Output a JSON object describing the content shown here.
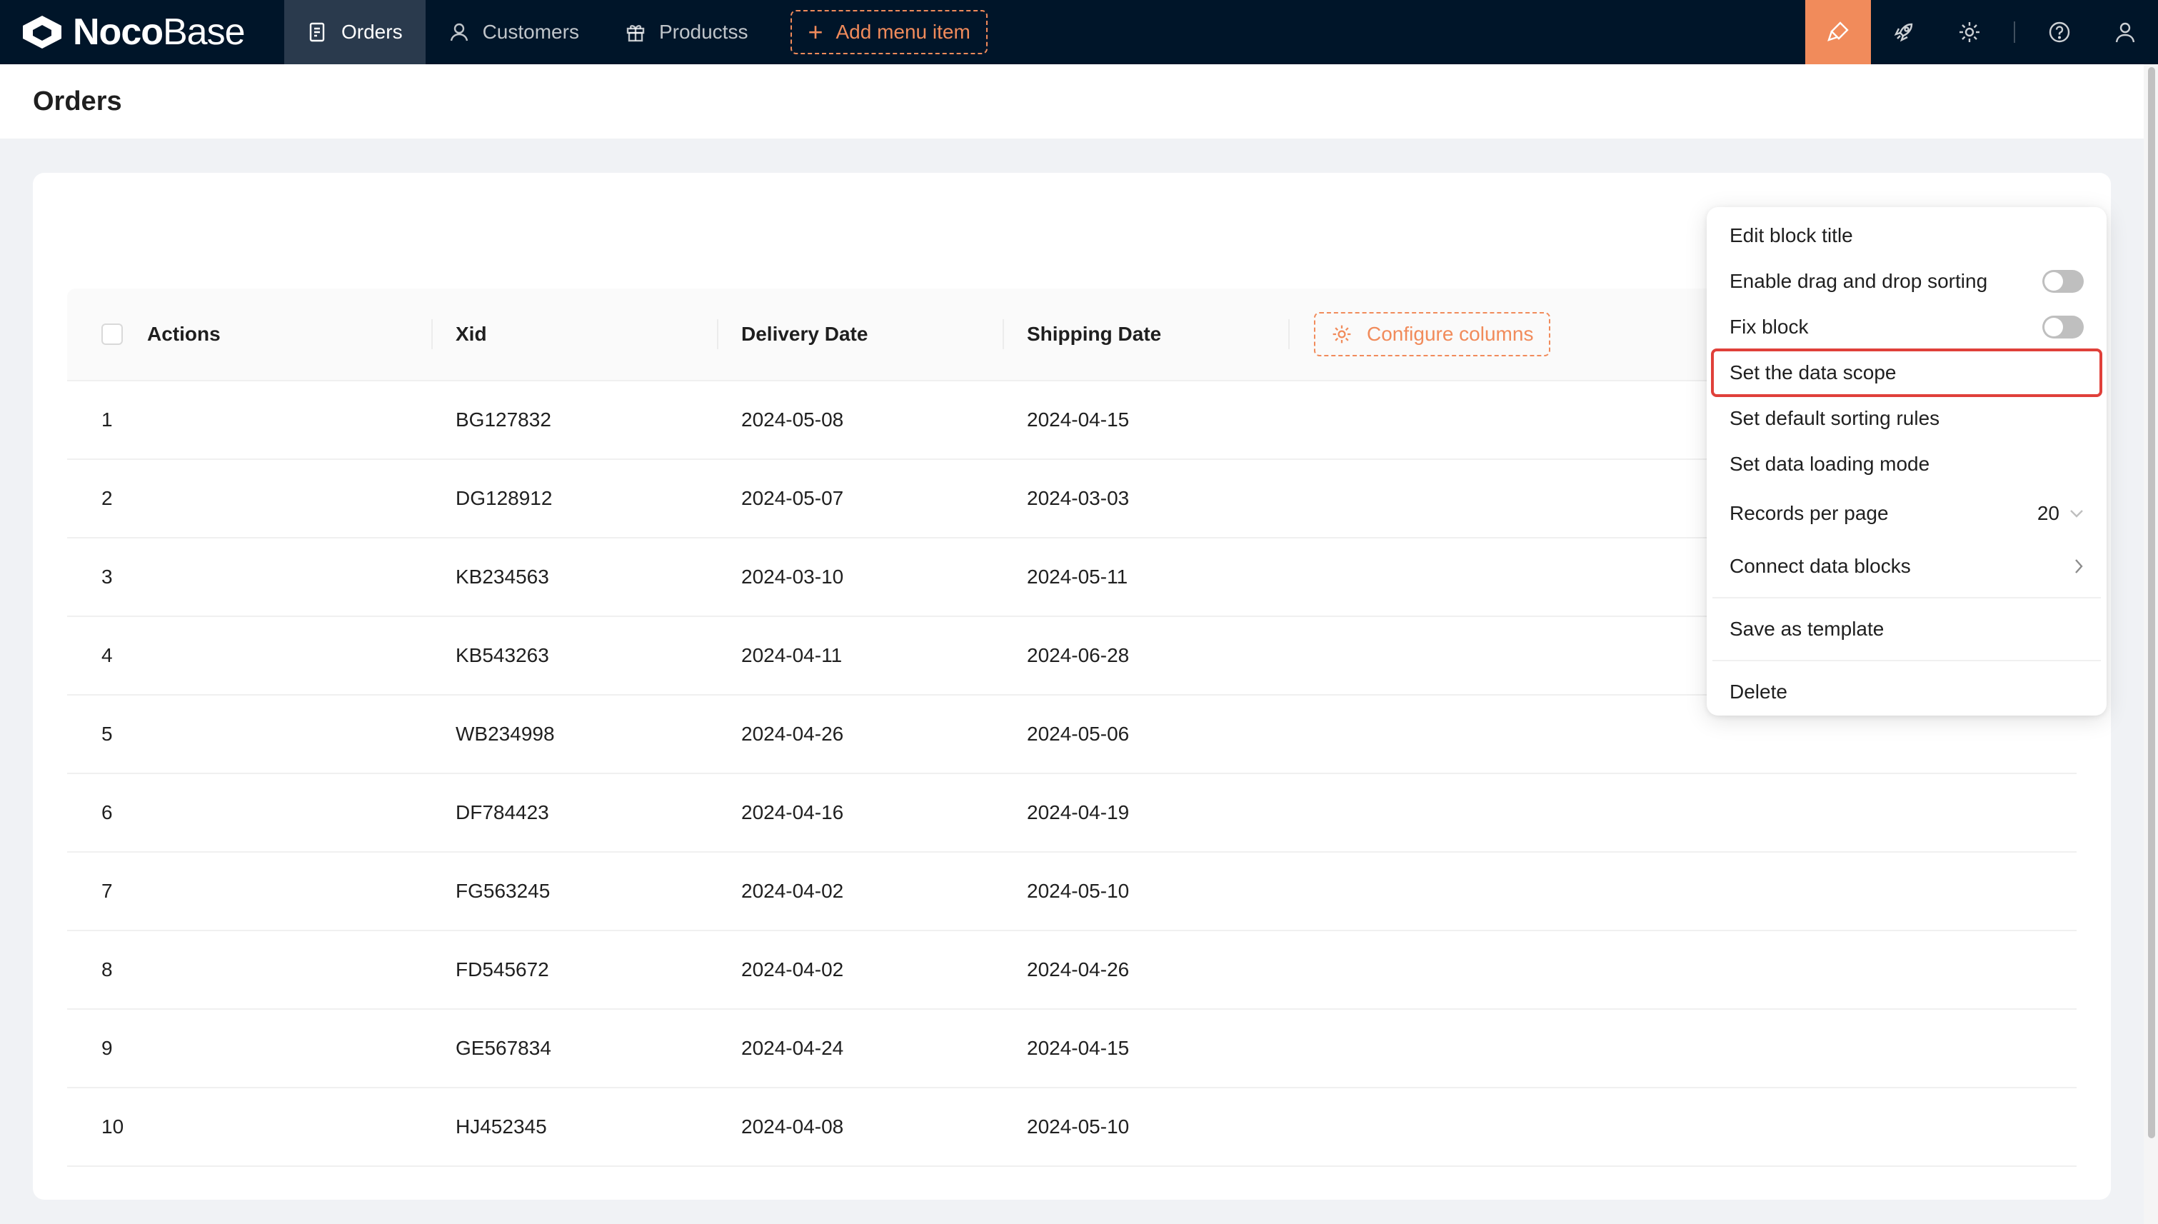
{
  "brand": {
    "bold": "Noco",
    "light": "Base"
  },
  "nav": {
    "items": [
      {
        "label": "Orders",
        "icon": "file-text-icon",
        "active": true
      },
      {
        "label": "Customers",
        "icon": "user-icon",
        "active": false
      },
      {
        "label": "Productss",
        "icon": "gift-icon",
        "active": false
      }
    ],
    "add_menu_label": "Add menu item"
  },
  "topright": {
    "icons": [
      "highlighter-icon",
      "rocket-icon",
      "gear-icon",
      "help-icon",
      "user-icon"
    ],
    "accent": "#f18b5b"
  },
  "page": {
    "title": "Orders"
  },
  "table": {
    "columns": [
      "Actions",
      "Xid",
      "Delivery Date",
      "Shipping Date"
    ],
    "configure_label": "Configure columns",
    "rows": [
      {
        "n": "1",
        "xid": "BG127832",
        "delivery": "2024-05-08",
        "shipping": "2024-04-15"
      },
      {
        "n": "2",
        "xid": "DG128912",
        "delivery": "2024-05-07",
        "shipping": "2024-03-03"
      },
      {
        "n": "3",
        "xid": "KB234563",
        "delivery": "2024-03-10",
        "shipping": "2024-05-11"
      },
      {
        "n": "4",
        "xid": "KB543263",
        "delivery": "2024-04-11",
        "shipping": "2024-06-28"
      },
      {
        "n": "5",
        "xid": "WB234998",
        "delivery": "2024-04-26",
        "shipping": "2024-05-06"
      },
      {
        "n": "6",
        "xid": "DF784423",
        "delivery": "2024-04-16",
        "shipping": "2024-04-19"
      },
      {
        "n": "7",
        "xid": "FG563245",
        "delivery": "2024-04-02",
        "shipping": "2024-05-10"
      },
      {
        "n": "8",
        "xid": "FD545672",
        "delivery": "2024-04-02",
        "shipping": "2024-04-26"
      },
      {
        "n": "9",
        "xid": "GE567834",
        "delivery": "2024-04-24",
        "shipping": "2024-04-15"
      },
      {
        "n": "10",
        "xid": "HJ452345",
        "delivery": "2024-04-08",
        "shipping": "2024-05-10"
      }
    ]
  },
  "menu": {
    "edit_title": "Edit block title",
    "drag_sort": "Enable drag and drop sorting",
    "fix_block": "Fix block",
    "data_scope": "Set the data scope",
    "sorting_rules": "Set default sorting rules",
    "loading_mode": "Set data loading mode",
    "records_per_page": "Records per page",
    "records_value": "20",
    "connect_blocks": "Connect data blocks",
    "save_template": "Save as template",
    "delete": "Delete",
    "highlight_color": "#e0403a"
  }
}
